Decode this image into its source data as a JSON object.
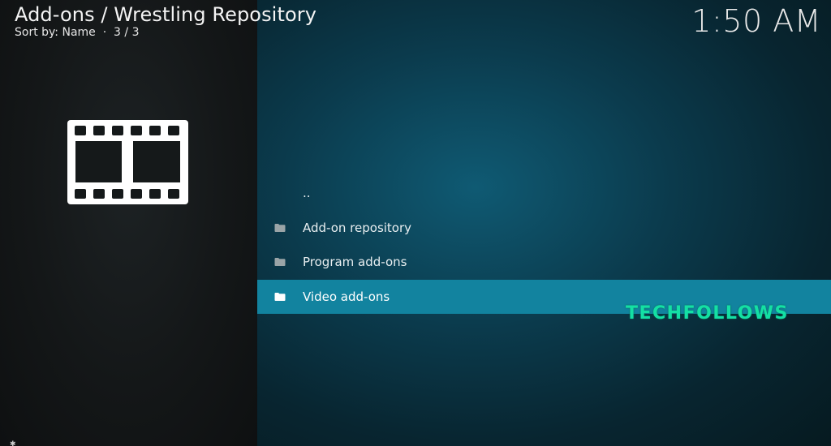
{
  "header": {
    "title": "Add-ons / Wrestling Repository",
    "sort_label": "Sort by: Name",
    "separator": "·",
    "position": "3 / 3"
  },
  "clock": "1:50 AM",
  "thumbnail_icon": "film-strip-icon",
  "list": {
    "items": [
      {
        "label": "..",
        "icon": ""
      },
      {
        "label": "Add-on repository",
        "icon": "folder-icon"
      },
      {
        "label": "Program add-ons",
        "icon": "folder-icon"
      },
      {
        "label": "Video add-ons",
        "icon": "folder-icon",
        "selected": true
      }
    ]
  },
  "watermark": "TECHFOLLOWS",
  "colors": {
    "selection": "#12839f",
    "watermark": "#14e0a4"
  }
}
